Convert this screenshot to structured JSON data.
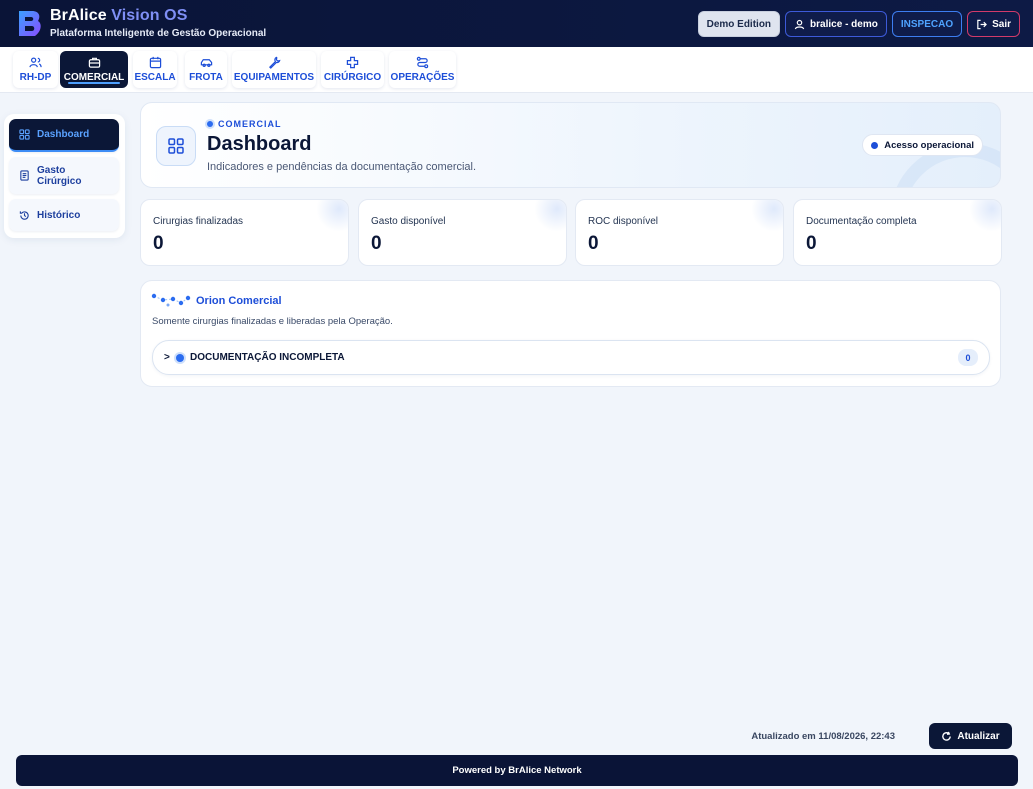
{
  "header": {
    "brand_name": "BrAlice",
    "brand_accent": "Vision OS",
    "subtitle": "Plataforma Inteligente de Gestão Operacional",
    "demo_label": "Demo Edition",
    "user_label": "bralice - demo",
    "role_label": "INSPECAO",
    "exit_label": "Sair"
  },
  "modules": [
    {
      "label": "RH-DP",
      "icon": "users-icon"
    },
    {
      "label": "COMERCIAL",
      "icon": "briefcase-icon",
      "active": true
    },
    {
      "label": "ESCALA",
      "icon": "calendar-icon"
    },
    {
      "label": "FROTA",
      "icon": "car-icon"
    },
    {
      "label": "EQUIPAMENTOS",
      "icon": "wrench-icon"
    },
    {
      "label": "CIRÚRGICO",
      "icon": "plus-icon"
    },
    {
      "label": "OPERAÇÕES",
      "icon": "route-icon"
    }
  ],
  "sidebar": {
    "items": [
      {
        "label": "Dashboard",
        "icon": "grid-icon",
        "active": true
      },
      {
        "label": "Gasto Cirúrgico",
        "icon": "document-icon"
      },
      {
        "label": "Histórico",
        "icon": "history-icon"
      }
    ]
  },
  "hero": {
    "eyebrow": "COMERCIAL",
    "title": "Dashboard",
    "subtitle": "Indicadores e pendências da documentação comercial.",
    "access_label": "Acesso operacional"
  },
  "stats": [
    {
      "label": "Cirurgias finalizadas",
      "value": "0"
    },
    {
      "label": "Gasto disponível",
      "value": "0"
    },
    {
      "label": "ROC disponível",
      "value": "0"
    },
    {
      "label": "Documentação completa",
      "value": "0"
    }
  ],
  "orion": {
    "title": "Orion Comercial",
    "subtitle": "Somente cirurgias finalizadas e liberadas pela Operação.",
    "section_label": "DOCUMENTAÇÃO INCOMPLETA",
    "section_count": "0",
    "chevron": ">"
  },
  "footer": {
    "updated_text": "Atualizado em 11/08/2026, 22:43",
    "refresh_label": "Atualizar",
    "powered_by": "Powered by BrAlice Network"
  },
  "colors": {
    "navy": "#0b1737",
    "accent_blue": "#1d4ed8",
    "exit_border": "#d23a6a",
    "background": "#f1f5fb"
  }
}
